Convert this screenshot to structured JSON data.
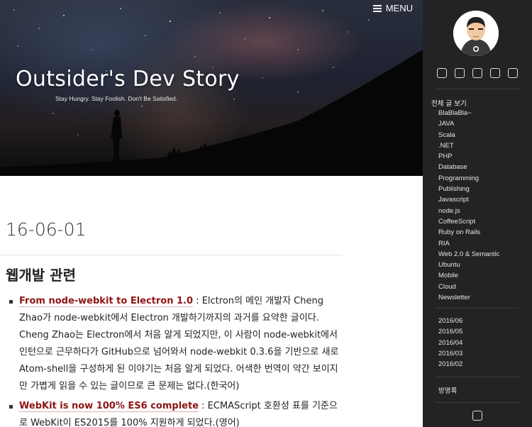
{
  "header": {
    "menu_label": "MENU",
    "site_title": "Outsider's Dev Story",
    "site_subtitle": "Stay Hungry. Stay Foolish. Don't Be Satisfied."
  },
  "post": {
    "date": "16-06-01",
    "section_title": "웹개발 관련",
    "items": [
      {
        "link": "From node-webkit to Electron 1.0",
        "text": " : Elctron의 메인 개발자 Cheng Zhao가 node-webkit에서 Electron 개발하기까지의 과거를 요약한 글이다. Cheng Zhao는 Electron에서 처음 알게 되었지만, 이 사람이 node-webkit에서 인턴으로 근무하다가 GitHub으로 넘어와서 node-webkit 0.3.6을 기반으로 새로 Atom-shell을 구성하게 된 이야기는 처음 알게 되었다. 어색한 번역이 약간 보이지만 가볍게 읽을 수 있는 글이므로 큰 문제는 없다.(한국어)"
      },
      {
        "link": "WebKit is now 100% ES6 complete",
        "text": " : ECMAScript 호환성 표를 기준으로 WebKit이 ES2015를 100% 지원하게 되었다.(영어)"
      }
    ]
  },
  "sidebar": {
    "social_icons": [
      "github-icon",
      "twitter-icon",
      "facebook-icon",
      "linkedin-icon",
      "link-icon"
    ],
    "categories_header": "전체 글 보기",
    "categories": [
      "BlaBlaBla~",
      "JAVA",
      "Scala",
      ".NET",
      "PHP",
      "Database",
      "Programming",
      "Publishing",
      "Javascript",
      "node.js",
      "CoffeeScript",
      "Ruby on Rails",
      "RIA",
      "Web 2.0 & Semantic",
      "Ubuntu",
      "Mobile",
      "Cloud",
      "Newsletter"
    ],
    "archives": [
      "2016/06",
      "2016/05",
      "2016/04",
      "2016/03",
      "2016/02"
    ],
    "guestbook": "방명록",
    "rss_icon": "rss-icon"
  }
}
